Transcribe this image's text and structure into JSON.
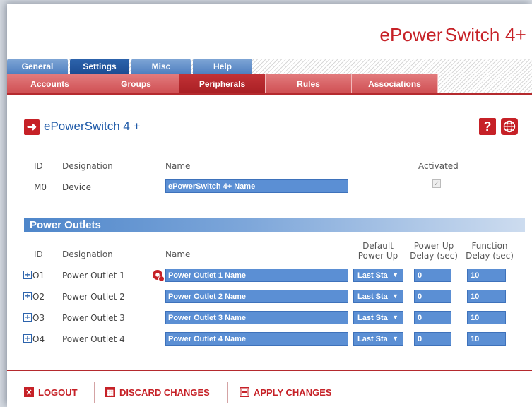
{
  "brand": {
    "part1": "ePower",
    "part2": "Switch 4+"
  },
  "tabs_top": [
    "General",
    "Settings",
    "Misc",
    "Help"
  ],
  "tabs_sub": [
    "Accounts",
    "Groups",
    "Peripherals",
    "Rules",
    "Associations"
  ],
  "page_title": "ePowerSwitch 4 +",
  "device": {
    "headers": {
      "id": "ID",
      "designation": "Designation",
      "name": "Name",
      "activated": "Activated"
    },
    "id": "M0",
    "designation": "Device",
    "name": "ePowerSwitch 4+ Name",
    "activated": true
  },
  "outlets": {
    "section_title": "Power Outlets",
    "headers": {
      "id": "ID",
      "designation": "Designation",
      "name": "Name",
      "default_power_up_1": "Default",
      "default_power_up_2": "Power Up",
      "power_up_delay_1": "Power Up",
      "power_up_delay_2": "Delay (sec)",
      "function_delay_1": "Function",
      "function_delay_2": "Delay (sec)"
    },
    "rows": [
      {
        "id": "O1",
        "designation": "Power Outlet 1",
        "name": "Power Outlet 1 Name",
        "default": "Last Sta",
        "delay": "0",
        "function": "10"
      },
      {
        "id": "O2",
        "designation": "Power Outlet 2",
        "name": "Power Outlet 2 Name",
        "default": "Last Sta",
        "delay": "0",
        "function": "10"
      },
      {
        "id": "O3",
        "designation": "Power Outlet 3",
        "name": "Power Outlet 3 Name",
        "default": "Last Sta",
        "delay": "0",
        "function": "10"
      },
      {
        "id": "O4",
        "designation": "Power Outlet 4",
        "name": "Power Outlet 4 Name",
        "default": "Last Sta",
        "delay": "0",
        "function": "10"
      }
    ]
  },
  "footer": {
    "logout": "LOGOUT",
    "discard": "DISCARD CHANGES",
    "apply": "APPLY CHANGES"
  },
  "colors": {
    "accent_red": "#c62127",
    "accent_blue": "#2d64ad",
    "field_blue": "#5b8fd4"
  }
}
